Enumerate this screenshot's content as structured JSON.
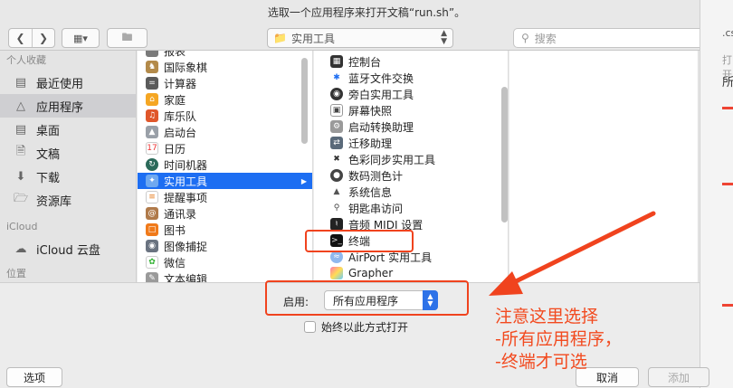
{
  "window": {
    "title": "选取一个应用程序来打开文稿“run.sh”。"
  },
  "toolbar": {
    "location": "实用工具",
    "search_placeholder": "搜索"
  },
  "sidebar": {
    "favorites_header": "个人收藏",
    "items": [
      "最近使用",
      "应用程序",
      "桌面",
      "文稿",
      "下载",
      "资源库"
    ],
    "icloud_header": "iCloud",
    "icloud_items": [
      "iCloud 云盘"
    ],
    "partial_header": "位置"
  },
  "column1": {
    "items": [
      "报表",
      "国际象棋",
      "计算器",
      "家庭",
      "库乐队",
      "启动台",
      "日历",
      "时间机器",
      "实用工具",
      "提醒事项",
      "通讯录",
      "图书",
      "图像捕捉",
      "微信",
      "文本编辑"
    ]
  },
  "column2": {
    "items": [
      "控制台",
      "蓝牙文件交换",
      "旁白实用工具",
      "屏幕快照",
      "启动转换助理",
      "迁移助理",
      "色彩同步实用工具",
      "数码测色计",
      "系统信息",
      "钥匙串访问",
      "音频 MIDI 设置",
      "终端",
      "AirPort 实用工具",
      "Grapher"
    ]
  },
  "bottom": {
    "enable_label": "启用:",
    "enable_value": "所有应用程序",
    "always_open": "始终以此方式打开",
    "options_button": "选项",
    "cancel_button": "取消",
    "add_button": "添加"
  },
  "annotation": {
    "line1": "注意这里选择",
    "line2": "-所有应用程序，",
    "line3": "-终端才可选"
  },
  "background_window": {
    "fragment1": ".cs",
    "fragment2": "打开",
    "fragment3": "所"
  },
  "colors": {
    "selection": "#1d6ef2",
    "annotation": "#f0431e"
  }
}
